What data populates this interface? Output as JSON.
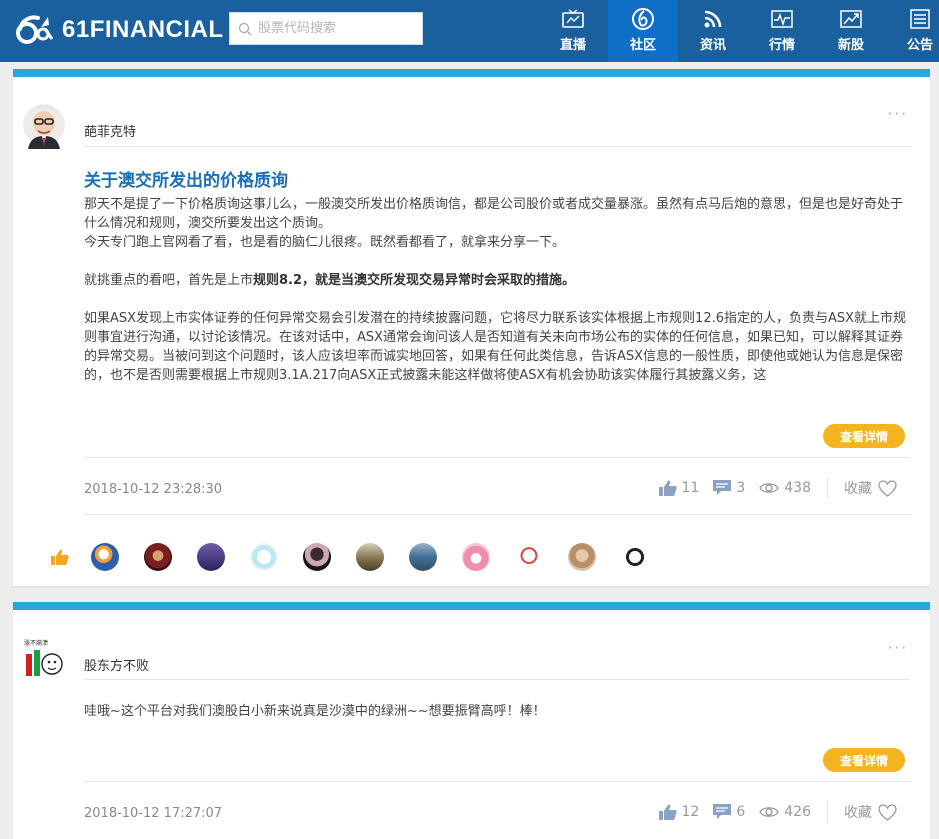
{
  "header": {
    "brand": "61FINANCIAL",
    "search_placeholder": "股票代码搜索",
    "nav": [
      {
        "label": "直播",
        "icon": "live-tv-icon"
      },
      {
        "label": "社区",
        "icon": "community-icon"
      },
      {
        "label": "资讯",
        "icon": "rss-news-icon"
      },
      {
        "label": "行情",
        "icon": "market-chart-icon"
      },
      {
        "label": "新股",
        "icon": "ipo-trend-icon"
      },
      {
        "label": "公告",
        "icon": "announcement-icon"
      }
    ],
    "active_nav": "社区"
  },
  "posts": [
    {
      "author": "葩菲克特",
      "title": "关于澳交所发出的价格质询",
      "paragraphs": [
        "那天不是提了一下价格质询这事儿么，一般澳交所发出价格质询信，都是公司股价或者成交量暴涨。虽然有点马后炮的意思，但是也是好奇处于什么情况和规则，澳交所要发出这个质询。",
        "今天专门跑上官网看了看，也是看的脑仁儿很疼。既然看都看了，就拿来分享一下。",
        "",
        "就挑重点的看吧，首先是上市",
        "",
        "如果ASX发现上市实体证券的任何异常交易会引发潜在的持续披露问题，它将尽力联系该实体根据上市规则12.6指定的人，负责与ASX就上市规则事宜进行沟通，以讨论该情况。在该对话中，ASX通常会询问该人是否知道有关未向市场公布的实体的任何信息，如果已知，可以解释其证券的异常交易。当被问到这个问题时，该人应该坦率而诚实地回答，如果有任何此类信息，告诉ASX信息的一般性质，即使他或她认为信息是保密的，也不是否则需要根据上市规则3.1A.217向ASX正式披露未能这样做将使ASX有机会协助该实体履行其披露义务，这"
      ],
      "highlight_bold": "规则8.2，就是当澳交所发现交易异常时会采取的措施。",
      "detail_label": "查看详情",
      "timestamp": "2018-10-12 23:28:30",
      "likes": "11",
      "comments": "3",
      "views": "438",
      "favorite_label": "收藏",
      "liker_count": 11
    },
    {
      "author": "股东方不败",
      "body": "哇哦~这个平台对我们澳股白小新来说真是沙漠中的绿洲~~想要振臂高呼！棒！",
      "detail_label": "查看详情",
      "timestamp": "2018-10-12 17:27:07",
      "likes": "12",
      "comments": "6",
      "views": "426",
      "favorite_label": "收藏"
    }
  ],
  "colors": {
    "topbar": "#1a5f9e",
    "active_tab": "#0f6ec7",
    "card_accent": "#2aa6dd",
    "title": "#1a6fb5",
    "detail_button": "#f5b41f",
    "like_orange": "#f5a623"
  }
}
